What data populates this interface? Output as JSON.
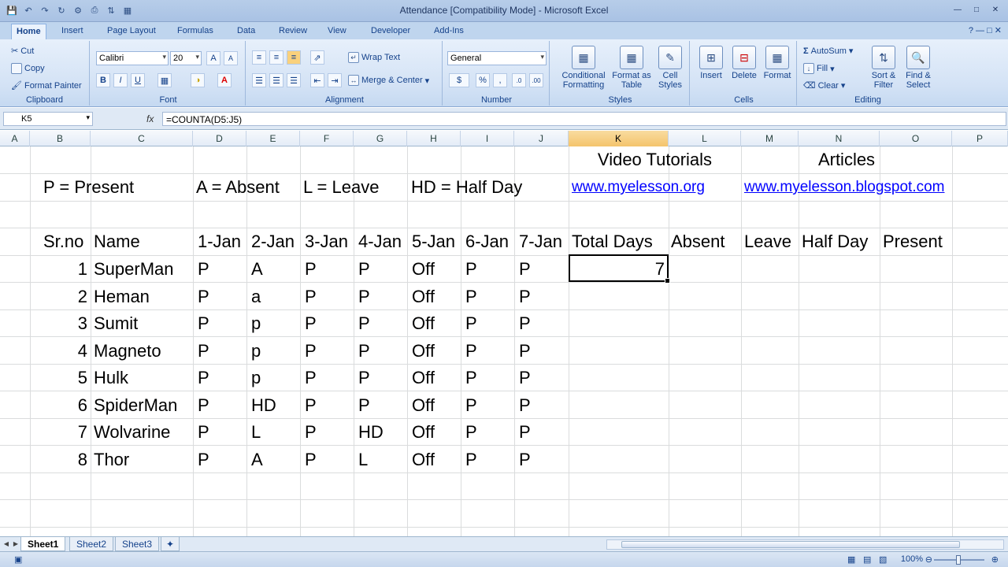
{
  "window": {
    "title": "Attendance  [Compatibility Mode] - Microsoft Excel"
  },
  "ribbon_tabs": [
    "Home",
    "Insert",
    "Page Layout",
    "Formulas",
    "Data",
    "Review",
    "View",
    "Developer",
    "Add-Ins"
  ],
  "ribbon": {
    "clipboard": {
      "label": "Clipboard",
      "cut": "Cut",
      "copy": "Copy",
      "format_painter": "Format Painter"
    },
    "font": {
      "label": "Font",
      "font_name": "Calibri",
      "font_size": "20"
    },
    "alignment": {
      "label": "Alignment",
      "wrap_text": "Wrap Text",
      "merge_center": "Merge & Center"
    },
    "number": {
      "label": "Number",
      "format": "General",
      "currency": "$",
      "percent": "%",
      "comma": ","
    },
    "styles": {
      "label": "Styles",
      "conditional_formatting": "Conditional Formatting",
      "format_as_table": "Format as Table",
      "cell_styles": "Cell Styles"
    },
    "cells": {
      "label": "Cells",
      "insert": "Insert",
      "delete": "Delete",
      "format": "Format"
    },
    "editing": {
      "label": "Editing",
      "autosum": "AutoSum",
      "fill": "Fill",
      "clear": "Clear",
      "sort_filter": "Sort & Filter",
      "find_select": "Find & Select"
    }
  },
  "formula_bar": {
    "name_box": "K5",
    "fx": "fx",
    "formula": "=COUNTA(D5:J5)"
  },
  "columns": [
    "A",
    "B",
    "C",
    "D",
    "E",
    "F",
    "G",
    "H",
    "I",
    "J",
    "K",
    "L",
    "M",
    "N",
    "O",
    "P"
  ],
  "sheet": {
    "video_tutorials": "Video Tutorials",
    "articles": "Articles",
    "legend_present": "P = Present",
    "legend_absent": "A = Absent",
    "legend_leave": "L = Leave",
    "legend_halfday": "HD = Half Day",
    "link_video": "www.myelesson.org",
    "link_articles": "www.myelesson.blogspot.com",
    "headers": [
      "Sr.no",
      "Name",
      "1-Jan",
      "2-Jan",
      "3-Jan",
      "4-Jan",
      "5-Jan",
      "6-Jan",
      "7-Jan",
      "Total Days",
      "Absent",
      "Leave",
      "Half Day",
      "Present"
    ],
    "rows": [
      {
        "sr": "1",
        "name": "SuperMan",
        "days": [
          "P",
          "A",
          "P",
          "P",
          "Off",
          "P",
          "P"
        ],
        "total": "7"
      },
      {
        "sr": "2",
        "name": "Heman",
        "days": [
          "P",
          "a",
          "P",
          "P",
          "Off",
          "P",
          "P"
        ],
        "total": ""
      },
      {
        "sr": "3",
        "name": "Sumit",
        "days": [
          "P",
          "p",
          "P",
          "P",
          "Off",
          "P",
          "P"
        ],
        "total": ""
      },
      {
        "sr": "4",
        "name": "Magneto",
        "days": [
          "P",
          "p",
          "P",
          "P",
          "Off",
          "P",
          "P"
        ],
        "total": ""
      },
      {
        "sr": "5",
        "name": "Hulk",
        "days": [
          "P",
          "p",
          "P",
          "P",
          "Off",
          "P",
          "P"
        ],
        "total": ""
      },
      {
        "sr": "6",
        "name": "SpiderMan",
        "days": [
          "P",
          "HD",
          "P",
          "P",
          "Off",
          "P",
          "P"
        ],
        "total": ""
      },
      {
        "sr": "7",
        "name": "Wolvarine",
        "days": [
          "P",
          "L",
          "P",
          "HD",
          "Off",
          "P",
          "P"
        ],
        "total": ""
      },
      {
        "sr": "8",
        "name": "Thor",
        "days": [
          "P",
          "A",
          "P",
          "L",
          "Off",
          "P",
          "P"
        ],
        "total": ""
      }
    ]
  },
  "sheet_tabs": [
    "Sheet1",
    "Sheet2",
    "Sheet3"
  ],
  "status": {
    "zoom": "100%"
  }
}
